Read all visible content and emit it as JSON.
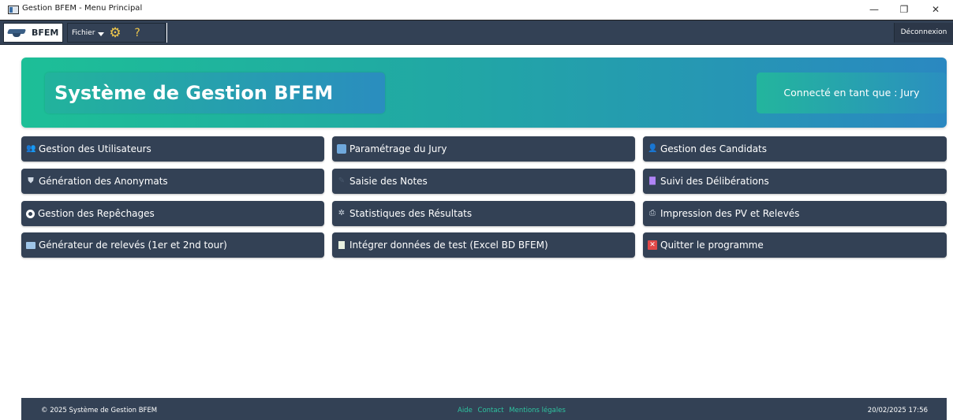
{
  "window": {
    "title": "Gestion BFEM - Menu Principal"
  },
  "toolbar": {
    "logo_text": "BFEM",
    "menu_label": "Fichier",
    "settings_icon": "gear-icon",
    "help_icon": "?",
    "logout_label": "Déconnexion"
  },
  "banner": {
    "title": "Système de Gestion BFEM",
    "user_label": "Connecté en tant que : Jury"
  },
  "menu": [
    {
      "label": "Gestion des Utilisateurs",
      "icon": "users-icon"
    },
    {
      "label": "Paramétrage du Jury",
      "icon": "jury-icon"
    },
    {
      "label": "Gestion des Candidats",
      "icon": "candidates-icon"
    },
    {
      "label": "Génération des Anonymats",
      "icon": "shield-icon"
    },
    {
      "label": "Saisie des Notes",
      "icon": "edit-icon"
    },
    {
      "label": "Suivi des Délibérations",
      "icon": "chart-icon"
    },
    {
      "label": "Gestion des Repêchages",
      "icon": "circle-icon"
    },
    {
      "label": "Statistiques des Résultats",
      "icon": "stats-icon"
    },
    {
      "label": "Impression des PV et Relevés",
      "icon": "printer-icon"
    },
    {
      "label": "Générateur de relevés (1er et 2nd tour)",
      "icon": "sheet-icon"
    },
    {
      "label": "Intégrer données de test (Excel BD BFEM)",
      "icon": "excel-icon"
    },
    {
      "label": "Quitter le programme",
      "icon": "close-icon"
    }
  ],
  "footer": {
    "copyright": "© 2025 Système de Gestion BFEM",
    "links": [
      "Aide",
      "Contact",
      "Mentions légales"
    ],
    "datetime": "20/02/2025 17:56"
  },
  "colors": {
    "toolbar_bg": "#334155",
    "button_bg": "#334155",
    "accent_green": "#1dbf97",
    "accent_blue": "#2a88c1"
  }
}
